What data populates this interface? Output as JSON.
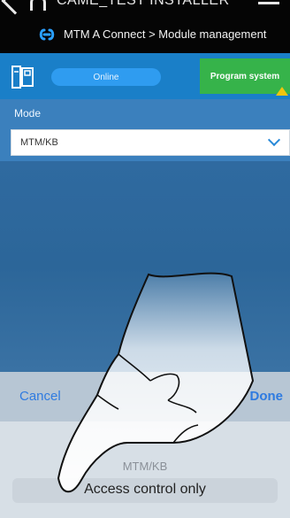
{
  "header": {
    "installer_name": "CAME_TEST INSTALLER",
    "breadcrumb": "MTM A Connect > Module management"
  },
  "toolbar": {
    "status": "Online",
    "program_button": "Program system"
  },
  "mode": {
    "label": "Mode",
    "selected_value": "MTM/KB"
  },
  "picker": {
    "cancel": "Cancel",
    "done": "Done",
    "options": [
      "MTM/KB",
      "Access control only"
    ]
  },
  "colors": {
    "accent_blue": "#1a7fc8",
    "program_green": "#36b34a",
    "link_blue": "#2f7be0",
    "warning_yellow": "#f1c40f"
  }
}
